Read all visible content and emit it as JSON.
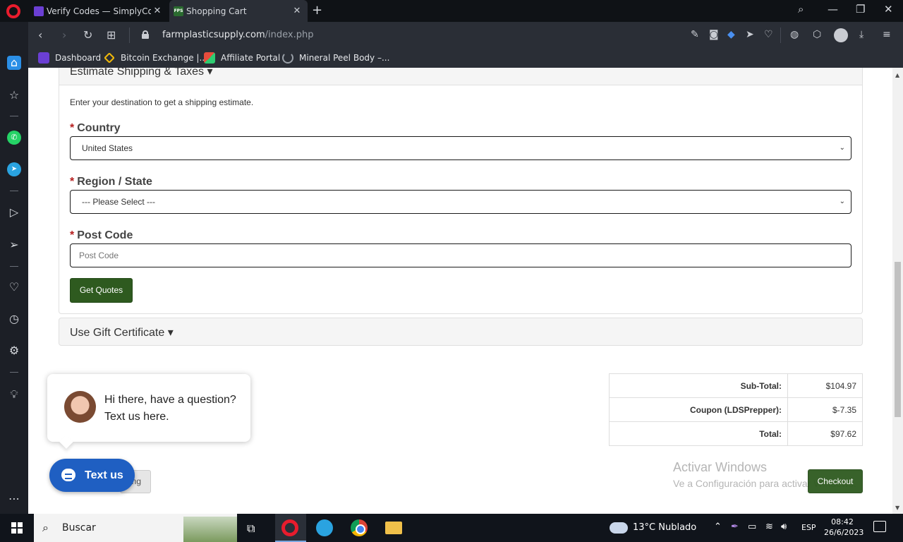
{
  "browser": {
    "tabs": [
      {
        "title": "Verify Codes — SimplyCodes",
        "active": false
      },
      {
        "title": "Shopping Cart",
        "favicon_text": "FPS",
        "active": true
      }
    ],
    "url_domain": "farmplasticsupply.com",
    "url_path": "/index.php",
    "bookmarks": [
      {
        "label": "Dashboard"
      },
      {
        "label": "Bitcoin Exchange |..."
      },
      {
        "label": "Affiliate Portal"
      },
      {
        "label": "Mineral Peel Body –..."
      }
    ]
  },
  "page": {
    "shipping": {
      "header": "Estimate Shipping & Taxes",
      "intro": "Enter your destination to get a shipping estimate.",
      "country_label": "Country",
      "country_value": "United States",
      "region_label": "Region / State",
      "region_value": "--- Please Select ---",
      "postcode_label": "Post Code",
      "postcode_placeholder": "Post Code",
      "quote_button": "Get Quotes"
    },
    "gift": {
      "header": "Use Gift Certificate"
    },
    "totals": [
      {
        "label": "Sub-Total:",
        "value": "$104.97"
      },
      {
        "label": "Coupon (LDSPrepper):",
        "value": "$-7.35"
      },
      {
        "label": "Total:",
        "value": "$97.62"
      }
    ],
    "continue_fragment": "ng",
    "checkout_button": "Checkout",
    "chat": {
      "message": "Hi there, have a question? Text us here.",
      "button": "Text us"
    },
    "watermark": {
      "line1": "Activar Windows",
      "line2": "Ve a Configuración para activar Windows."
    }
  },
  "taskbar": {
    "search_label": "Buscar",
    "weather": "13°C  Nublado",
    "language": "ESP",
    "time": "08:42",
    "date": "26/6/2023"
  },
  "colors": {
    "button_green": "#2e5a1f",
    "required_star": "#b51e1e",
    "textus_blue": "#1f5fc2",
    "browser_chrome": "#2a2e36"
  }
}
